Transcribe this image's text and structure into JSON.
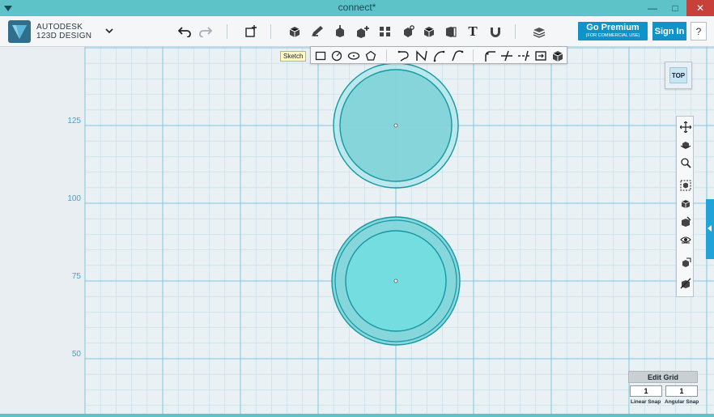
{
  "window": {
    "title": "connect*"
  },
  "brand": {
    "line1": "AUTODESK",
    "line2": "123D DESIGN"
  },
  "toolbar": {
    "premium_label": "Go Premium",
    "premium_sub": "(FOR COMMERCIAL USE)",
    "signin_label": "Sign In",
    "help_label": "?",
    "text_tool_glyph": "T"
  },
  "sketch": {
    "tooltip": "Sketch"
  },
  "viewcube": {
    "face": "TOP"
  },
  "axis": {
    "labels": [
      "125",
      "100",
      "75",
      "50"
    ]
  },
  "edit_grid": {
    "title": "Edit Grid",
    "linear_value": "1",
    "angular_value": "1",
    "linear_label": "Linear Snap",
    "angular_label": "Angular Snap"
  },
  "colors": {
    "accent": "#0f93c9",
    "titlebar": "#5ec3c8",
    "shape_fill": "#7fd3d8",
    "shape_stroke": "#1497a3",
    "grid_major": "#7fc6e3",
    "grid_minor": "#c9e2ec"
  }
}
